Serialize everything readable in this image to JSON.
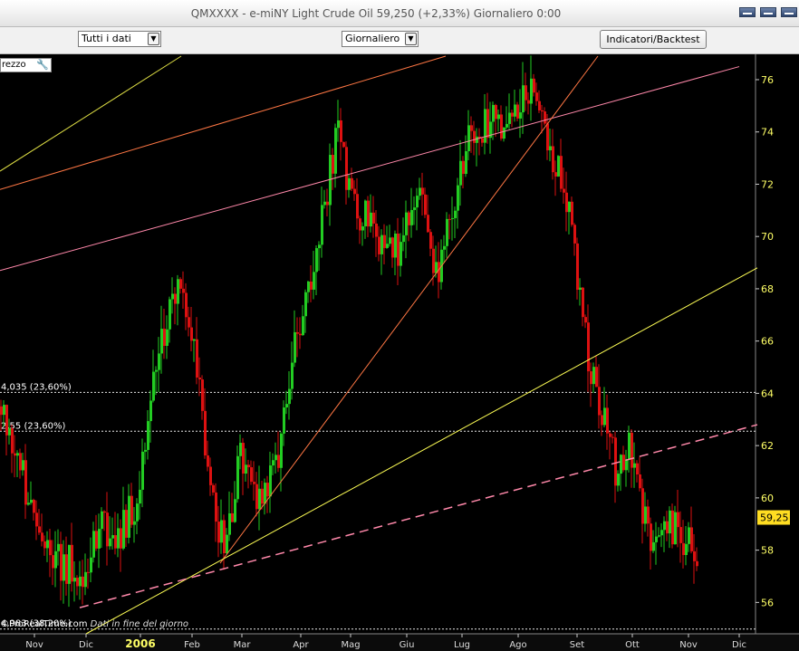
{
  "window": {
    "title": "QMXXXX - e-miNY Light Crude Oil    59,250  (+2,33%)    Giornaliero  0:00",
    "buttons": [
      "minimize-button",
      "restore-button",
      "close-button"
    ]
  },
  "toolbar": {
    "range_select": "Tutti i dati",
    "period_select": "Giornaliero",
    "indicators_button": "Indicatori/Backtest"
  },
  "panel": {
    "label": "rezzo",
    "footer_source": "©ProRealTime.com",
    "footer_note": "Dati in fine del giorno"
  },
  "colors": {
    "background": "#000000",
    "up": "#22cc22",
    "down": "#dd1111",
    "axis_text": "#ffff66",
    "price_badge": "#ffdd22"
  },
  "chart_data": {
    "type": "candlestick",
    "title": "e-miNY Light Crude Oil",
    "y_ticks": [
      56,
      58,
      60,
      62,
      64,
      66,
      68,
      70,
      72,
      74,
      76
    ],
    "ylim": [
      54.8,
      76.9
    ],
    "x_ticks": [
      "Nov",
      "Dic",
      "2006",
      "Feb",
      "Mar",
      "Apr",
      "Mag",
      "Giu",
      "Lug",
      "Ago",
      "Set",
      "Ott",
      "Nov",
      "Dic"
    ],
    "last_price": "59,25",
    "fib_levels": [
      {
        "label": "4,035 (23,60%)",
        "value": 64.035
      },
      {
        "label": "2,55 (23,60%)",
        "value": 62.55
      },
      {
        "label": "4,983 (38,20%)",
        "value": 54.983
      }
    ],
    "bar_anchors": [
      [
        0,
        63.5
      ],
      [
        20,
        61.5
      ],
      [
        40,
        58.5
      ],
      [
        60,
        57.5
      ],
      [
        75,
        57.5
      ],
      [
        90,
        56.5
      ],
      [
        110,
        59.0
      ],
      [
        130,
        58.5
      ],
      [
        150,
        60.0
      ],
      [
        165,
        63.5
      ],
      [
        180,
        66.5
      ],
      [
        195,
        68.0
      ],
      [
        210,
        66.5
      ],
      [
        225,
        62.0
      ],
      [
        245,
        58.0
      ],
      [
        265,
        61.5
      ],
      [
        285,
        60.0
      ],
      [
        305,
        61.0
      ],
      [
        325,
        66.0
      ],
      [
        345,
        69.0
      ],
      [
        360,
        72.0
      ],
      [
        372,
        74.2
      ],
      [
        385,
        71.5
      ],
      [
        405,
        70.5
      ],
      [
        425,
        69.0
      ],
      [
        445,
        70.0
      ],
      [
        460,
        72.5
      ],
      [
        475,
        68.5
      ],
      [
        490,
        69.5
      ],
      [
        505,
        72.5
      ],
      [
        520,
        74.0
      ],
      [
        535,
        74.5
      ],
      [
        555,
        74.0
      ],
      [
        575,
        75.0
      ],
      [
        590,
        76.0
      ],
      [
        605,
        73.0
      ],
      [
        620,
        72.0
      ],
      [
        635,
        69.0
      ],
      [
        650,
        65.0
      ],
      [
        665,
        63.0
      ],
      [
        680,
        61.0
      ],
      [
        695,
        62.0
      ],
      [
        710,
        59.0
      ],
      [
        725,
        58.5
      ],
      [
        740,
        59.0
      ],
      [
        755,
        58.5
      ],
      [
        768,
        58.0
      ]
    ],
    "trendlines": [
      {
        "from": [
          0,
          72.5
        ],
        "to": [
          200,
          76.9
        ],
        "color": "#dddd44",
        "dash": false
      },
      {
        "from": [
          0,
          71.8
        ],
        "to": [
          492,
          76.9
        ],
        "color": "#ff7744",
        "dash": false
      },
      {
        "from": [
          0,
          68.7
        ],
        "to": [
          816,
          76.5
        ],
        "color": "#ff88aa",
        "dash": false
      },
      {
        "from": [
          243,
          57.5
        ],
        "to": [
          660,
          76.9
        ],
        "color": "#ff7744",
        "dash": false
      },
      {
        "from": [
          95,
          54.8
        ],
        "to": [
          836,
          68.8
        ],
        "color": "#ffff55",
        "dash": false
      },
      {
        "from": [
          88,
          55.8
        ],
        "to": [
          836,
          62.8
        ],
        "color": "#ff88aa",
        "dash": true
      }
    ]
  }
}
